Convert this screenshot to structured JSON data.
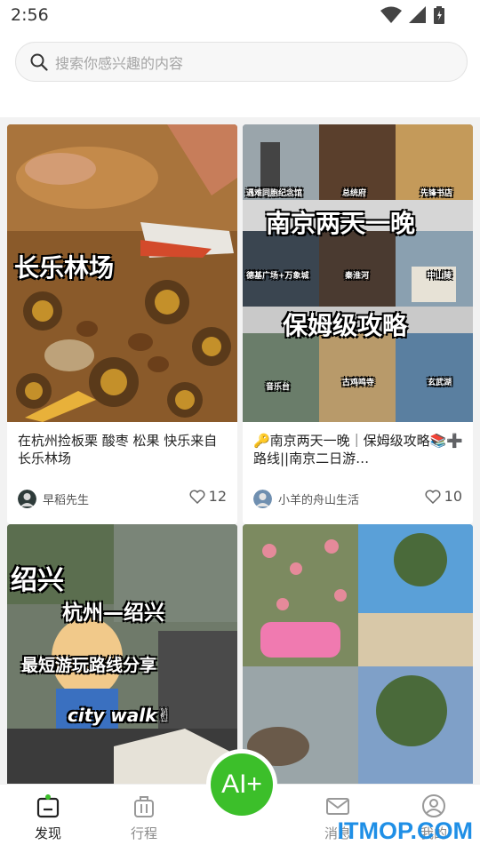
{
  "status_bar": {
    "time": "2:56"
  },
  "search": {
    "placeholder": "搜索你感兴趣的内容"
  },
  "cards": [
    {
      "overlay": [
        "长乐林场"
      ],
      "title": "在杭州捡板栗 酸枣 松果 快乐来自长乐林场",
      "author": "早稻先生",
      "likes": "12"
    },
    {
      "overlay": [
        "南京两天一晚",
        "保姆级攻略"
      ],
      "captions": [
        "遇难同胞纪念馆",
        "总统府",
        "先锋书店",
        "德基广场+万象城",
        "秦淮河",
        "中山陵",
        "音乐台",
        "古鸡鸣寺",
        "玄武湖"
      ],
      "title": "🔑南京两天一晚｜保姆级攻略📚➕路线||南京二日游…",
      "author": "小羊的舟山生活",
      "likes": "10"
    },
    {
      "overlay": [
        "绍兴",
        "杭州—绍兴",
        "最短游玩路线分享",
        "city walk✌"
      ],
      "title": "",
      "author": "",
      "likes": ""
    },
    {
      "overlay": [],
      "title": "",
      "author": "",
      "likes": ""
    }
  ],
  "nav": {
    "items": [
      {
        "label": "发现",
        "icon": "discover-icon"
      },
      {
        "label": "行程",
        "icon": "luggage-icon"
      },
      {
        "label": "消息",
        "icon": "mail-icon"
      },
      {
        "label": "我的",
        "icon": "profile-icon"
      }
    ],
    "ai_label": "AI+"
  },
  "watermark": "ITMOP.COM",
  "colors": {
    "accent": "#3cbf2a",
    "watermark": "#1f8fe6"
  }
}
